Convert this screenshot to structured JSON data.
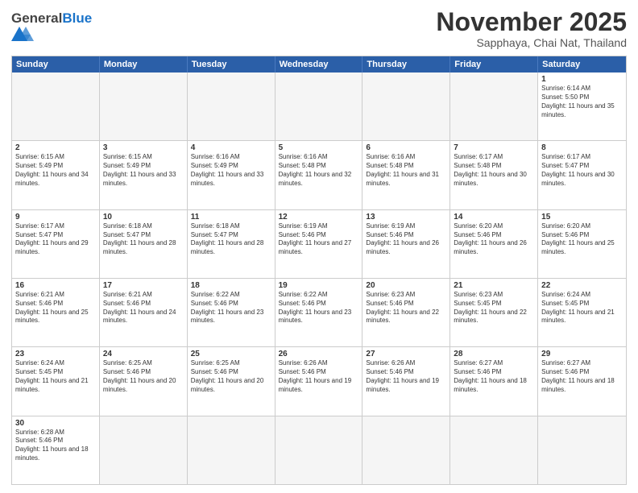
{
  "logo": {
    "text_general": "General",
    "text_blue": "Blue"
  },
  "title": "November 2025",
  "location": "Sapphaya, Chai Nat, Thailand",
  "header_days": [
    "Sunday",
    "Monday",
    "Tuesday",
    "Wednesday",
    "Thursday",
    "Friday",
    "Saturday"
  ],
  "weeks": [
    [
      {
        "day": "",
        "empty": true
      },
      {
        "day": "",
        "empty": true
      },
      {
        "day": "",
        "empty": true
      },
      {
        "day": "",
        "empty": true
      },
      {
        "day": "",
        "empty": true
      },
      {
        "day": "",
        "empty": true
      },
      {
        "day": "1",
        "sunrise": "6:14 AM",
        "sunset": "5:50 PM",
        "daylight": "11 hours and 35 minutes."
      }
    ],
    [
      {
        "day": "2",
        "sunrise": "6:15 AM",
        "sunset": "5:49 PM",
        "daylight": "11 hours and 34 minutes."
      },
      {
        "day": "3",
        "sunrise": "6:15 AM",
        "sunset": "5:49 PM",
        "daylight": "11 hours and 33 minutes."
      },
      {
        "day": "4",
        "sunrise": "6:16 AM",
        "sunset": "5:49 PM",
        "daylight": "11 hours and 33 minutes."
      },
      {
        "day": "5",
        "sunrise": "6:16 AM",
        "sunset": "5:48 PM",
        "daylight": "11 hours and 32 minutes."
      },
      {
        "day": "6",
        "sunrise": "6:16 AM",
        "sunset": "5:48 PM",
        "daylight": "11 hours and 31 minutes."
      },
      {
        "day": "7",
        "sunrise": "6:17 AM",
        "sunset": "5:48 PM",
        "daylight": "11 hours and 30 minutes."
      },
      {
        "day": "8",
        "sunrise": "6:17 AM",
        "sunset": "5:47 PM",
        "daylight": "11 hours and 30 minutes."
      }
    ],
    [
      {
        "day": "9",
        "sunrise": "6:17 AM",
        "sunset": "5:47 PM",
        "daylight": "11 hours and 29 minutes."
      },
      {
        "day": "10",
        "sunrise": "6:18 AM",
        "sunset": "5:47 PM",
        "daylight": "11 hours and 28 minutes."
      },
      {
        "day": "11",
        "sunrise": "6:18 AM",
        "sunset": "5:47 PM",
        "daylight": "11 hours and 28 minutes."
      },
      {
        "day": "12",
        "sunrise": "6:19 AM",
        "sunset": "5:46 PM",
        "daylight": "11 hours and 27 minutes."
      },
      {
        "day": "13",
        "sunrise": "6:19 AM",
        "sunset": "5:46 PM",
        "daylight": "11 hours and 26 minutes."
      },
      {
        "day": "14",
        "sunrise": "6:20 AM",
        "sunset": "5:46 PM",
        "daylight": "11 hours and 26 minutes."
      },
      {
        "day": "15",
        "sunrise": "6:20 AM",
        "sunset": "5:46 PM",
        "daylight": "11 hours and 25 minutes."
      }
    ],
    [
      {
        "day": "16",
        "sunrise": "6:21 AM",
        "sunset": "5:46 PM",
        "daylight": "11 hours and 25 minutes."
      },
      {
        "day": "17",
        "sunrise": "6:21 AM",
        "sunset": "5:46 PM",
        "daylight": "11 hours and 24 minutes."
      },
      {
        "day": "18",
        "sunrise": "6:22 AM",
        "sunset": "5:46 PM",
        "daylight": "11 hours and 23 minutes."
      },
      {
        "day": "19",
        "sunrise": "6:22 AM",
        "sunset": "5:46 PM",
        "daylight": "11 hours and 23 minutes."
      },
      {
        "day": "20",
        "sunrise": "6:23 AM",
        "sunset": "5:46 PM",
        "daylight": "11 hours and 22 minutes."
      },
      {
        "day": "21",
        "sunrise": "6:23 AM",
        "sunset": "5:45 PM",
        "daylight": "11 hours and 22 minutes."
      },
      {
        "day": "22",
        "sunrise": "6:24 AM",
        "sunset": "5:45 PM",
        "daylight": "11 hours and 21 minutes."
      }
    ],
    [
      {
        "day": "23",
        "sunrise": "6:24 AM",
        "sunset": "5:45 PM",
        "daylight": "11 hours and 21 minutes."
      },
      {
        "day": "24",
        "sunrise": "6:25 AM",
        "sunset": "5:46 PM",
        "daylight": "11 hours and 20 minutes."
      },
      {
        "day": "25",
        "sunrise": "6:25 AM",
        "sunset": "5:46 PM",
        "daylight": "11 hours and 20 minutes."
      },
      {
        "day": "26",
        "sunrise": "6:26 AM",
        "sunset": "5:46 PM",
        "daylight": "11 hours and 19 minutes."
      },
      {
        "day": "27",
        "sunrise": "6:26 AM",
        "sunset": "5:46 PM",
        "daylight": "11 hours and 19 minutes."
      },
      {
        "day": "28",
        "sunrise": "6:27 AM",
        "sunset": "5:46 PM",
        "daylight": "11 hours and 18 minutes."
      },
      {
        "day": "29",
        "sunrise": "6:27 AM",
        "sunset": "5:46 PM",
        "daylight": "11 hours and 18 minutes."
      }
    ],
    [
      {
        "day": "30",
        "sunrise": "6:28 AM",
        "sunset": "5:46 PM",
        "daylight": "11 hours and 18 minutes."
      },
      {
        "day": "",
        "empty": true
      },
      {
        "day": "",
        "empty": true
      },
      {
        "day": "",
        "empty": true
      },
      {
        "day": "",
        "empty": true
      },
      {
        "day": "",
        "empty": true
      },
      {
        "day": "",
        "empty": true
      }
    ]
  ],
  "labels": {
    "sunrise": "Sunrise:",
    "sunset": "Sunset:",
    "daylight": "Daylight:"
  }
}
